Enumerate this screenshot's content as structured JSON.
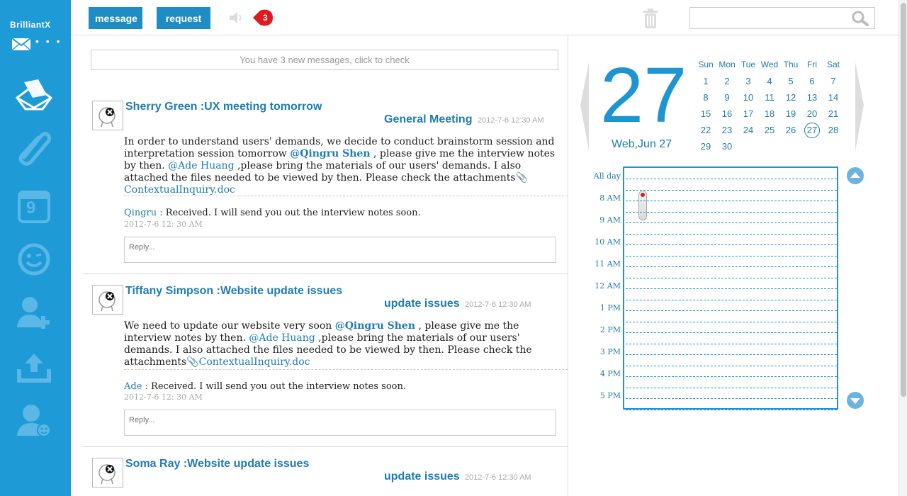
{
  "brand": {
    "name": "BrilliantX"
  },
  "sidebar": {
    "items": [
      {
        "icon": "inbox-icon"
      },
      {
        "icon": "attachment-icon"
      },
      {
        "icon": "calendar-icon",
        "day": "9"
      },
      {
        "icon": "emoticon-icon"
      },
      {
        "icon": "add-user-icon"
      },
      {
        "icon": "upload-icon"
      },
      {
        "icon": "user-status-icon"
      }
    ]
  },
  "toolbar": {
    "message_label": "message",
    "request_label": "request",
    "notification_count": "3",
    "search_placeholder": ""
  },
  "feed": {
    "new_messages_text": "You have 3 new messages, click to check",
    "threads": [
      {
        "subject": "Sherry Green :UX meeting tomorrow",
        "category": "General Meeting",
        "timestamp": "2012-7-6 12:30 AM",
        "body_1": "In order to understand users' demands, we decide to conduct brainstorm session and interpretation session tomorrow ",
        "mention_1": "@Qingru Shen",
        "body_2": " , please give me the interview notes by then. ",
        "mention_2": "@Ade Huang",
        "body_3": " ,please bring the materials of our users' demands. I also attached the files needed to be viewed by then. Please check the attachments",
        "attachment": "ContextualInquiry.doc",
        "reply_author": "Qingru :",
        "reply_text": " Received. I will send you out the interview notes soon.",
        "reply_time": "2012-7-6 12:  30 AM",
        "reply_placeholder": "Reply..."
      },
      {
        "subject": "Tiffany Simpson :Website update issues",
        "category": "update issues",
        "timestamp": "2012-7-6 12:30 AM",
        "body_1": "We need to update our website very soon ",
        "mention_1": "@Qingru Shen",
        "body_2": " , please give me the interview notes by then. ",
        "mention_2": "@Ade Huang",
        "body_3": " ,please bring the materials of our users' demands. I also attached the files needed to be viewed by then. Please check the attachments",
        "attachment": "ContextualInquiry.doc",
        "reply_author": "Ade :",
        "reply_text": " Received. I will send you out the interview notes soon.",
        "reply_time": "2012-7-6 12:  30 AM",
        "reply_placeholder": "Reply..."
      },
      {
        "subject": "Soma Ray :Website update issues",
        "category": "update issues",
        "timestamp": "2012-7-6 12:30 AM"
      }
    ]
  },
  "calendar": {
    "big_day": "27",
    "date_label": "Web,Jun 27",
    "weekdays": [
      "Sun",
      "Mon",
      "Tue",
      "Wed",
      "Thu",
      "Fri",
      "Sat"
    ],
    "weeks": [
      [
        "1",
        "2",
        "3",
        "4",
        "5",
        "6",
        "7"
      ],
      [
        "8",
        "9",
        "10",
        "11",
        "12",
        "13",
        "14"
      ],
      [
        "15",
        "16",
        "17",
        "18",
        "19",
        "20",
        "21"
      ],
      [
        "22",
        "23",
        "24",
        "25",
        "26",
        "27",
        "28"
      ],
      [
        "29",
        "30"
      ]
    ],
    "today": "27",
    "time_slots": [
      "All day",
      "8 AM",
      "9 AM",
      "10 AM",
      "11 AM",
      "12 AM",
      "1 PM",
      "2 PM",
      "3 PM",
      "4 PM",
      "5 PM"
    ]
  },
  "colors": {
    "sidebar": "#1e9bd6",
    "accent": "#1f7cb4",
    "badge": "#e0191f"
  }
}
